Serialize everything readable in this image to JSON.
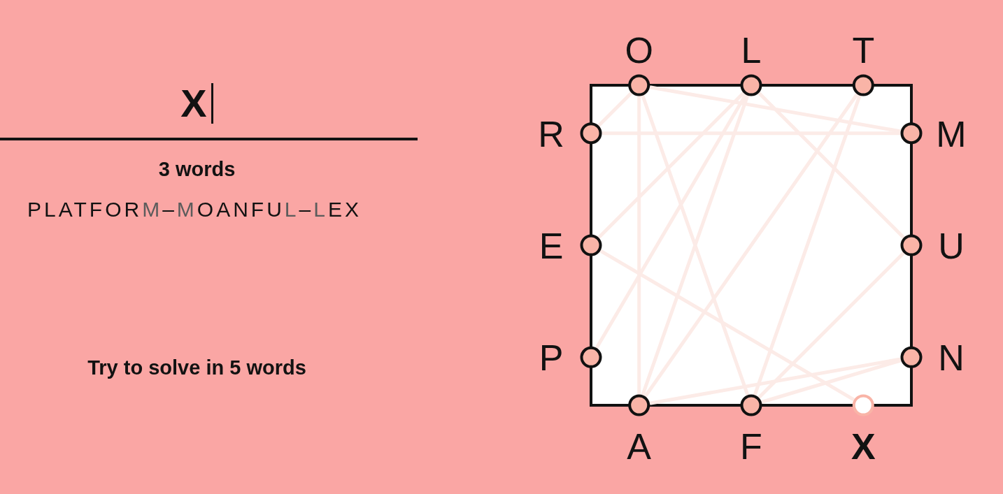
{
  "input": {
    "value": "X",
    "focused": true
  },
  "word_count": "3 words",
  "found_words": [
    {
      "word": "PLATFORM",
      "joiner": "–"
    },
    {
      "word": "MOANFUL",
      "joiner": "–"
    },
    {
      "word": "LEX"
    }
  ],
  "goal": "Try to solve in 5 words",
  "board": {
    "sides": [
      {
        "kind": "top",
        "letters": [
          {
            "letter": "O",
            "used": true,
            "selected": false
          },
          {
            "letter": "L",
            "used": true,
            "selected": false
          },
          {
            "letter": "T",
            "used": true,
            "selected": false
          }
        ]
      },
      {
        "kind": "right",
        "letters": [
          {
            "letter": "M",
            "used": true,
            "selected": false
          },
          {
            "letter": "U",
            "used": true,
            "selected": false
          },
          {
            "letter": "N",
            "used": true,
            "selected": false
          }
        ]
      },
      {
        "kind": "bottom",
        "letters": [
          {
            "letter": "A",
            "used": true,
            "selected": false
          },
          {
            "letter": "F",
            "used": true,
            "selected": false
          },
          {
            "letter": "X",
            "used": true,
            "selected": true
          }
        ]
      },
      {
        "kind": "left",
        "letters": [
          {
            "letter": "R",
            "used": true,
            "selected": false
          },
          {
            "letter": "E",
            "used": true,
            "selected": false
          },
          {
            "letter": "P",
            "used": true,
            "selected": false
          }
        ]
      }
    ]
  }
}
